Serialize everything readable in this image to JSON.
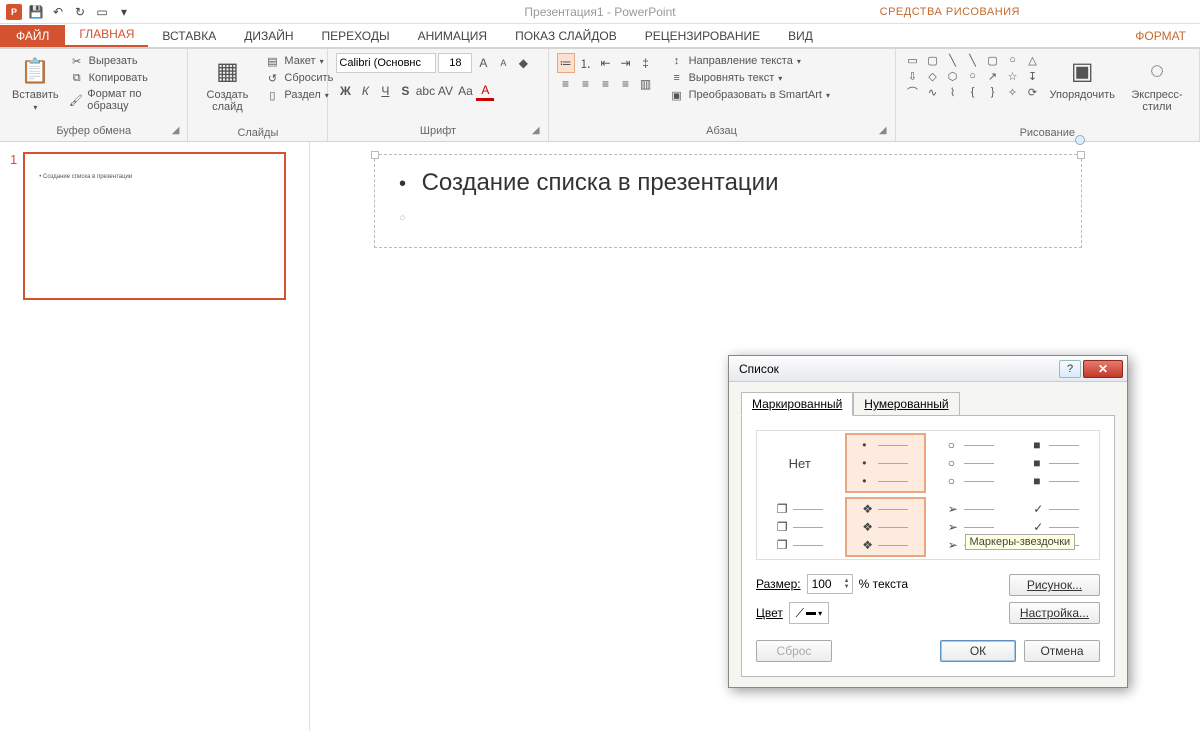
{
  "app": {
    "title": "Презентация1 - PowerPoint",
    "tools_title": "СРЕДСТВА РИСОВАНИЯ"
  },
  "tabs": {
    "file": "ФАЙЛ",
    "home": "ГЛАВНАЯ",
    "insert": "ВСТАВКА",
    "design": "ДИЗАЙН",
    "trans": "ПЕРЕХОДЫ",
    "anim": "АНИМАЦИЯ",
    "show": "ПОКАЗ СЛАЙДОВ",
    "review": "РЕЦЕНЗИРОВАНИЕ",
    "view": "ВИД",
    "format": "ФОРМАТ"
  },
  "ribbon": {
    "clipboard": {
      "label": "Буфер обмена",
      "paste": "Вставить",
      "cut": "Вырезать",
      "copy": "Копировать",
      "formatpainter": "Формат по образцу"
    },
    "slides": {
      "label": "Слайды",
      "newslide": "Создать слайд",
      "layout": "Макет",
      "reset": "Сбросить",
      "section": "Раздел"
    },
    "font": {
      "label": "Шрифт",
      "name": "Calibri (Основнс",
      "size": "18"
    },
    "para": {
      "label": "Абзац",
      "textdir": "Направление текста",
      "aligntext": "Выровнять текст",
      "smartart": "Преобразовать в SmartArt"
    },
    "drawing": {
      "label": "Рисование",
      "arrange": "Упорядочить",
      "quickstyles": "Экспресс-стили"
    }
  },
  "slide": {
    "number": "1",
    "thumb_text": "Создание списка в презентации",
    "text_line": "Создание списка в презентации"
  },
  "dialog": {
    "title": "Список",
    "tab_bulleted": "Маркированный",
    "tab_numbered": "Нумерованный",
    "none": "Нет",
    "tooltip": "Маркеры-звездочки",
    "size_label": "Размер:",
    "size_value": "100",
    "size_suffix": "% текста",
    "color_label": "Цвет",
    "btn_picture": "Рисунок...",
    "btn_customize": "Настройка...",
    "btn_reset": "Сброс",
    "btn_ok": "ОК",
    "btn_cancel": "Отмена"
  }
}
